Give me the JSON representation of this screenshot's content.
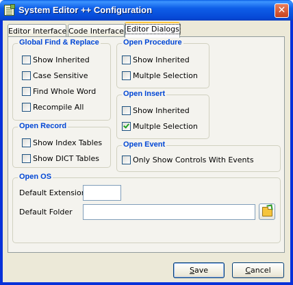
{
  "window": {
    "title": "System Editor ++ Configuration",
    "close_glyph": "✕",
    "icon": "app-editor-icon"
  },
  "tabs": [
    {
      "label": "Editor Interface",
      "active": false
    },
    {
      "label": "Code Interface",
      "active": false
    },
    {
      "label": "Editor Dialogs",
      "active": true
    }
  ],
  "groups": {
    "global_find_replace": {
      "title": "Global Find & Replace",
      "options": [
        {
          "label": "Show Inherited",
          "checked": false
        },
        {
          "label": "Case Sensitive",
          "checked": false
        },
        {
          "label": "Find Whole Word",
          "checked": false
        },
        {
          "label": "Recompile All",
          "checked": false
        }
      ]
    },
    "open_procedure": {
      "title": "Open Procedure",
      "options": [
        {
          "label": "Show Inherited",
          "checked": false
        },
        {
          "label": "Multple Selection",
          "checked": false
        }
      ]
    },
    "open_insert": {
      "title": "Open Insert",
      "options": [
        {
          "label": "Show Inherited",
          "checked": false
        },
        {
          "label": "Multple Selection",
          "checked": true
        }
      ]
    },
    "open_record": {
      "title": "Open Record",
      "options": [
        {
          "label": "Show Index Tables",
          "checked": false
        },
        {
          "label": "Show DICT Tables",
          "checked": false
        }
      ]
    },
    "open_event": {
      "title": "Open Event",
      "options": [
        {
          "label": "Only Show Controls With Events",
          "checked": false
        }
      ]
    },
    "open_os": {
      "title": "Open OS",
      "default_extension_label": "Default Extension",
      "default_extension_value": "",
      "default_folder_label": "Default Folder",
      "default_folder_value": "",
      "browse_icon": "folder-open-icon"
    }
  },
  "buttons": {
    "save": {
      "accel": "S",
      "rest": "ave"
    },
    "cancel": {
      "accel": "C",
      "rest": "ancel"
    }
  },
  "colors": {
    "title_bar": "#0a5fe6",
    "group_title": "#0046d5",
    "check_mark": "#21a121",
    "active_tab_highlight": "#ffc73d"
  }
}
